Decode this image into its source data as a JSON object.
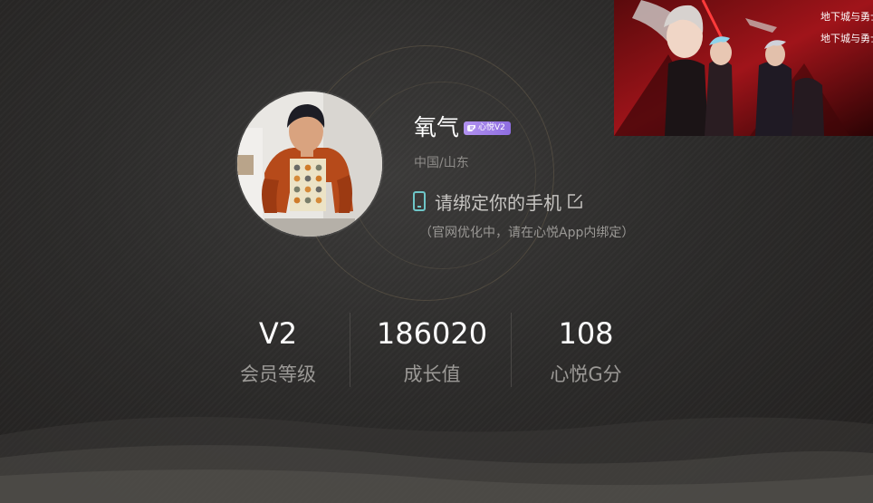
{
  "profile": {
    "nickname": "氧气",
    "vip_badge": "心悦V2",
    "location": "中国/山东",
    "bind_phone_label": "请绑定你的手机",
    "bind_phone_note": "（官网优化中，请在心悦App内绑定）"
  },
  "stats": [
    {
      "value": "V2",
      "label": "会员等级"
    },
    {
      "value": "186020",
      "label": "成长值"
    },
    {
      "value": "108",
      "label": "心悦G分"
    }
  ],
  "promo": {
    "logo_text": "地下城与勇士"
  },
  "colors": {
    "background": "#2c2b2a",
    "vip_badge": "#9b7be6",
    "phone_icon": "#6ec6c8",
    "muted_text": "#9b9996"
  },
  "icons": {
    "phone": "mobile-phone-icon",
    "edit": "edit-pencil-icon",
    "vip_wing": "wing-icon"
  }
}
